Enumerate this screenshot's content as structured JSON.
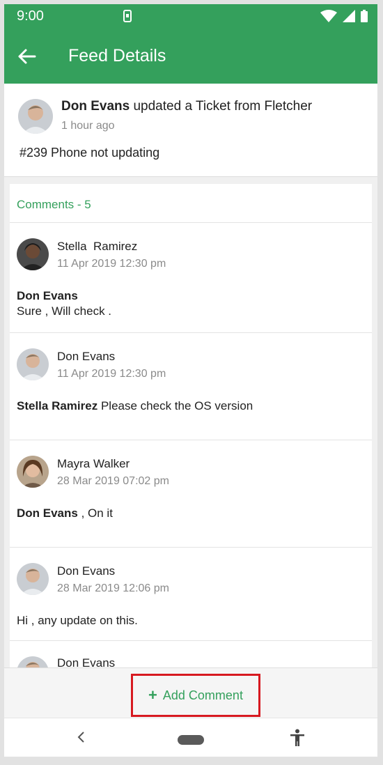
{
  "status_bar": {
    "time": "9:00"
  },
  "app_bar": {
    "title": "Feed Details"
  },
  "feed": {
    "author": "Don Evans",
    "action": " updated a Ticket from Fletcher",
    "time": "1 hour ago",
    "body": "#239 Phone not updating"
  },
  "comments": {
    "header": "Comments - 5",
    "items": [
      {
        "author": "Stella  Ramirez",
        "date": "11 Apr 2019 12:30 pm",
        "mention": "Don Evans",
        "text": "Sure , Will check ."
      },
      {
        "author": "Don Evans",
        "date": "11 Apr 2019 12:30 pm",
        "mention": "Stella Ramirez",
        "text": " Please check the OS version"
      },
      {
        "author": "Mayra Walker",
        "date": "28 Mar 2019 07:02 pm",
        "mention": "Don Evans",
        "text": " , On it"
      },
      {
        "author": "Don Evans",
        "date": "28 Mar 2019 12:06 pm",
        "mention": "",
        "text": "Hi , any update on this."
      },
      {
        "author": "Don Evans",
        "date": "",
        "mention": "",
        "text": ""
      }
    ]
  },
  "add_comment": {
    "label": "Add Comment"
  },
  "colors": {
    "primary": "#34a05c",
    "highlight": "#d71920"
  },
  "icons": [
    "phone-icon",
    "wifi-icon",
    "signal-icon",
    "battery-icon",
    "back-arrow-icon",
    "plus-icon",
    "nav-back-icon",
    "accessibility-icon"
  ]
}
